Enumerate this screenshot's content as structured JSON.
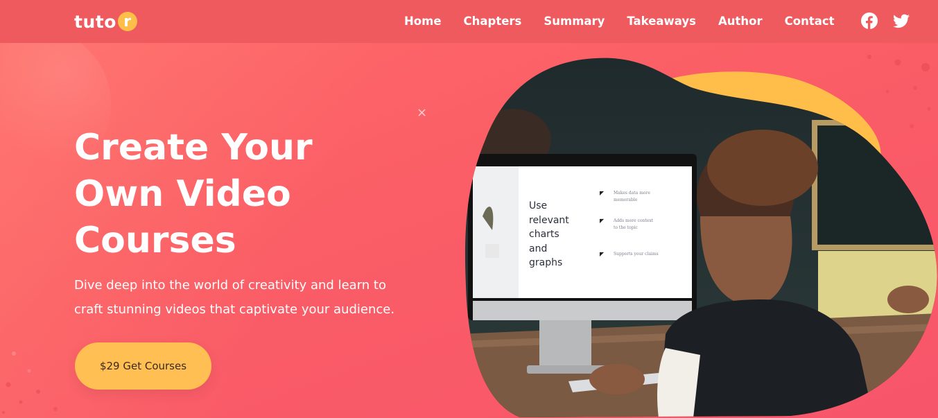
{
  "brand": {
    "logo_text": "tuto",
    "logo_badge": "r"
  },
  "nav": {
    "items": [
      {
        "label": "Home",
        "name": "nav-home"
      },
      {
        "label": "Chapters",
        "name": "nav-chapters"
      },
      {
        "label": "Summary",
        "name": "nav-summary"
      },
      {
        "label": "Takeaways",
        "name": "nav-takeaways"
      },
      {
        "label": "Author",
        "name": "nav-author"
      },
      {
        "label": "Contact",
        "name": "nav-contact"
      }
    ],
    "social": [
      "facebook-icon",
      "twitter-icon"
    ]
  },
  "hero": {
    "title_line1": "Create Your",
    "title_line2": "Own Video",
    "title_line3": "Courses",
    "description_line1": "Dive deep into the world of creativity and learn to",
    "description_line2": "craft stunning videos that captivate your audience.",
    "cta_label": "$29 Get Courses",
    "close_glyph": "×"
  },
  "screen_slide": {
    "heading_lines": [
      "Use",
      "relevant",
      "charts",
      "and",
      "graphs"
    ],
    "bullets": [
      "Makes data more memorable",
      "Adds more context to the topic",
      "Supports your claims"
    ]
  },
  "colors": {
    "background": "#fb5e66",
    "header": "#ef5a5e",
    "accent": "#ffbf52",
    "text": "#ffffff"
  }
}
